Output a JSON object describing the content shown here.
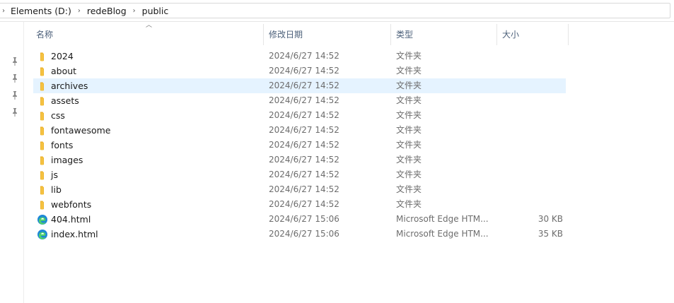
{
  "breadcrumb": {
    "items": [
      "Elements (D:)",
      "redeBlog",
      "public"
    ],
    "separator": "›"
  },
  "columns": {
    "name": "名称",
    "date": "修改日期",
    "type": "类型",
    "size": "大小",
    "sorted_by": "name",
    "sort_direction": "ascending"
  },
  "nav_pane": {
    "pins": [
      "pin-icon",
      "pin-icon",
      "pin-icon",
      "pin-icon"
    ]
  },
  "files": [
    {
      "name": "2024",
      "date": "2024/6/27 14:52",
      "type": "文件夹",
      "size": "",
      "icon": "folder-icon",
      "selected": false
    },
    {
      "name": "about",
      "date": "2024/6/27 14:52",
      "type": "文件夹",
      "size": "",
      "icon": "folder-icon",
      "selected": false
    },
    {
      "name": "archives",
      "date": "2024/6/27 14:52",
      "type": "文件夹",
      "size": "",
      "icon": "folder-icon",
      "selected": true
    },
    {
      "name": "assets",
      "date": "2024/6/27 14:52",
      "type": "文件夹",
      "size": "",
      "icon": "folder-icon",
      "selected": false
    },
    {
      "name": "css",
      "date": "2024/6/27 14:52",
      "type": "文件夹",
      "size": "",
      "icon": "folder-icon",
      "selected": false
    },
    {
      "name": "fontawesome",
      "date": "2024/6/27 14:52",
      "type": "文件夹",
      "size": "",
      "icon": "folder-icon",
      "selected": false
    },
    {
      "name": "fonts",
      "date": "2024/6/27 14:52",
      "type": "文件夹",
      "size": "",
      "icon": "folder-icon",
      "selected": false
    },
    {
      "name": "images",
      "date": "2024/6/27 14:52",
      "type": "文件夹",
      "size": "",
      "icon": "folder-icon",
      "selected": false
    },
    {
      "name": "js",
      "date": "2024/6/27 14:52",
      "type": "文件夹",
      "size": "",
      "icon": "folder-icon",
      "selected": false
    },
    {
      "name": "lib",
      "date": "2024/6/27 14:52",
      "type": "文件夹",
      "size": "",
      "icon": "folder-icon",
      "selected": false
    },
    {
      "name": "webfonts",
      "date": "2024/6/27 14:52",
      "type": "文件夹",
      "size": "",
      "icon": "folder-icon",
      "selected": false
    },
    {
      "name": "404.html",
      "date": "2024/6/27 15:06",
      "type": "Microsoft Edge HTM...",
      "size": "30 KB",
      "icon": "edge-html-icon",
      "selected": false
    },
    {
      "name": "index.html",
      "date": "2024/6/27 15:06",
      "type": "Microsoft Edge HTM...",
      "size": "35 KB",
      "icon": "edge-html-icon",
      "selected": false
    }
  ],
  "colors": {
    "selection": "#e5f3ff",
    "header_text": "#4c607a",
    "folder": "#f5c242",
    "edge": "#1e88d6"
  }
}
